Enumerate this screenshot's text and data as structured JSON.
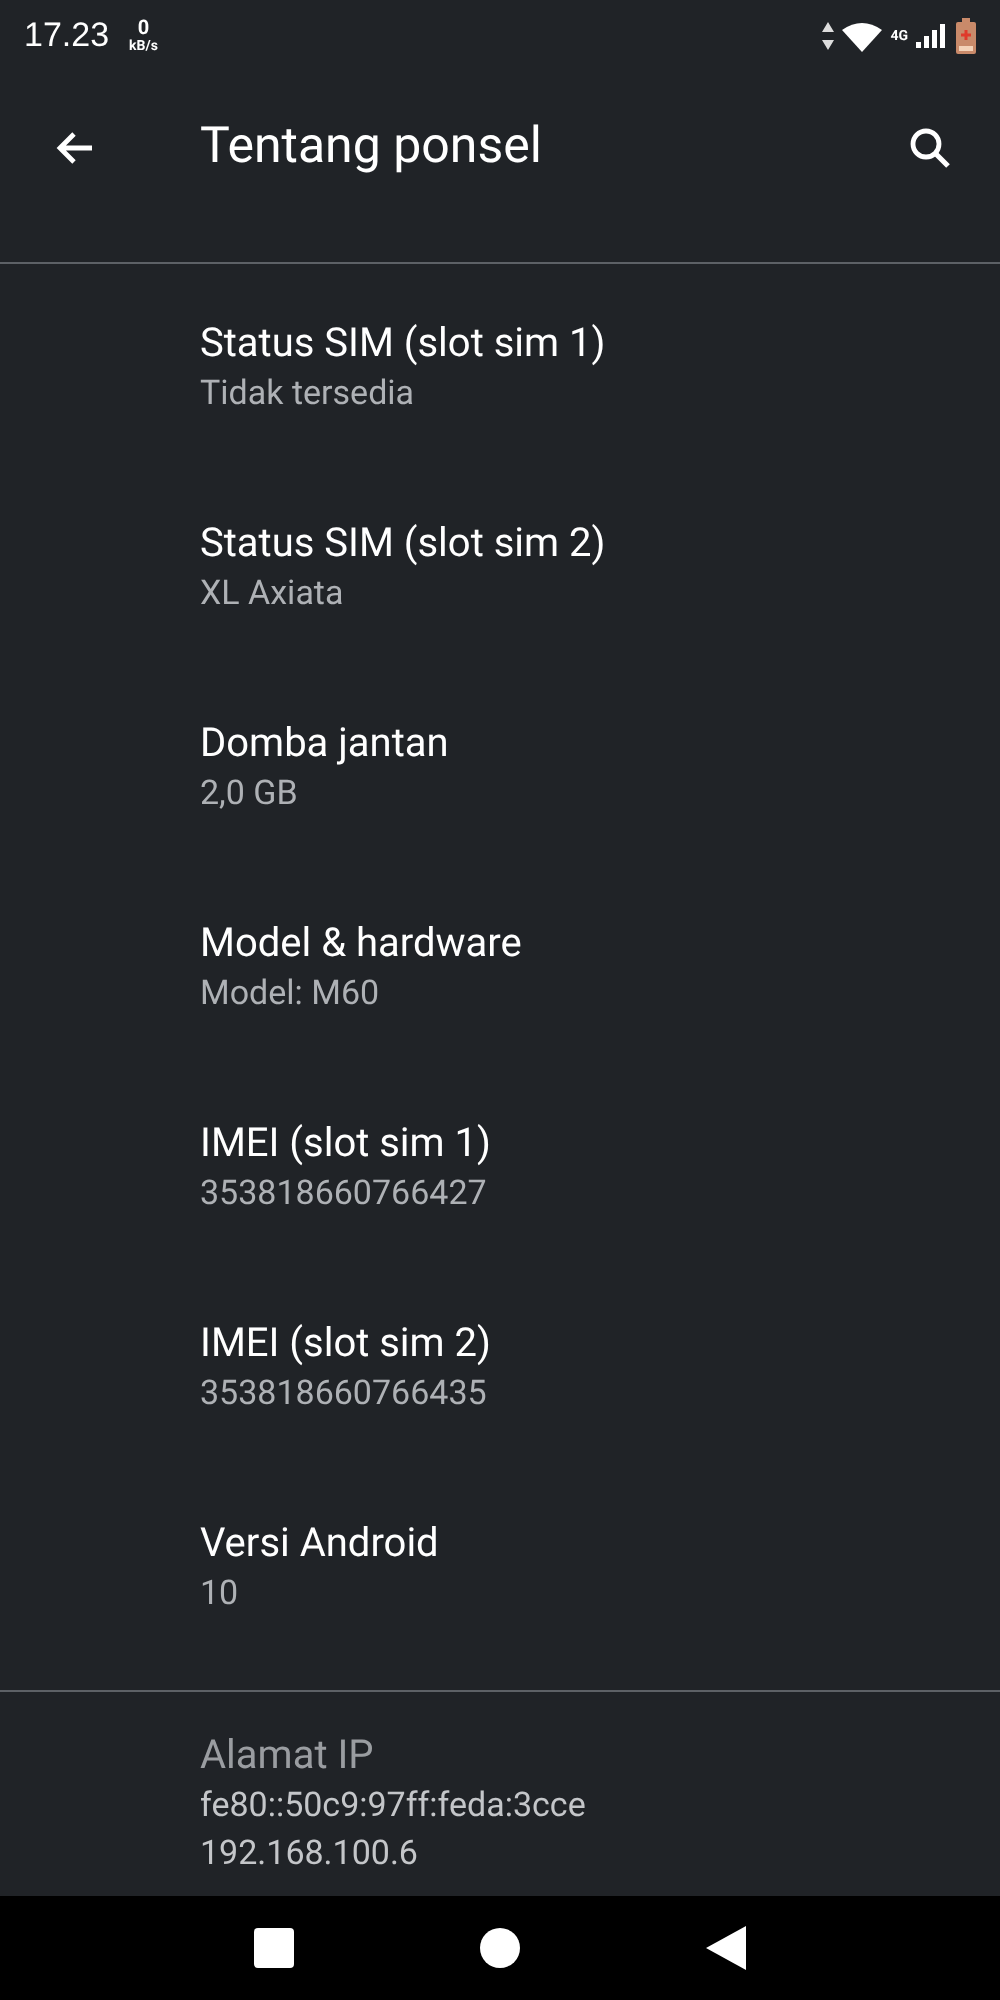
{
  "status_bar": {
    "time": "17.23",
    "speed_value": "0",
    "speed_unit": "kB/s",
    "network": "4G"
  },
  "toolbar": {
    "title": "Tentang ponsel"
  },
  "sections": [
    {
      "items": [
        {
          "title": "Status SIM (slot sim 1)",
          "lines": [
            "Tidak tersedia"
          ],
          "disabled": false
        },
        {
          "title": "Status SIM (slot sim 2)",
          "lines": [
            "XL Axiata"
          ],
          "disabled": false
        },
        {
          "title": "Domba jantan",
          "lines": [
            "2,0 GB"
          ],
          "disabled": false
        },
        {
          "title": "Model & hardware",
          "lines": [
            "Model: M60"
          ],
          "disabled": false
        },
        {
          "title": "IMEI (slot sim 1)",
          "lines": [
            "353818660766427"
          ],
          "disabled": false
        },
        {
          "title": "IMEI (slot sim 2)",
          "lines": [
            "353818660766435"
          ],
          "disabled": false
        },
        {
          "title": "Versi Android",
          "lines": [
            "10"
          ],
          "disabled": false
        }
      ]
    },
    {
      "items": [
        {
          "title": "Alamat IP",
          "lines": [
            "fe80::50c9:97ff:feda:3cce",
            "192.168.100.6"
          ],
          "disabled": true
        }
      ]
    }
  ]
}
